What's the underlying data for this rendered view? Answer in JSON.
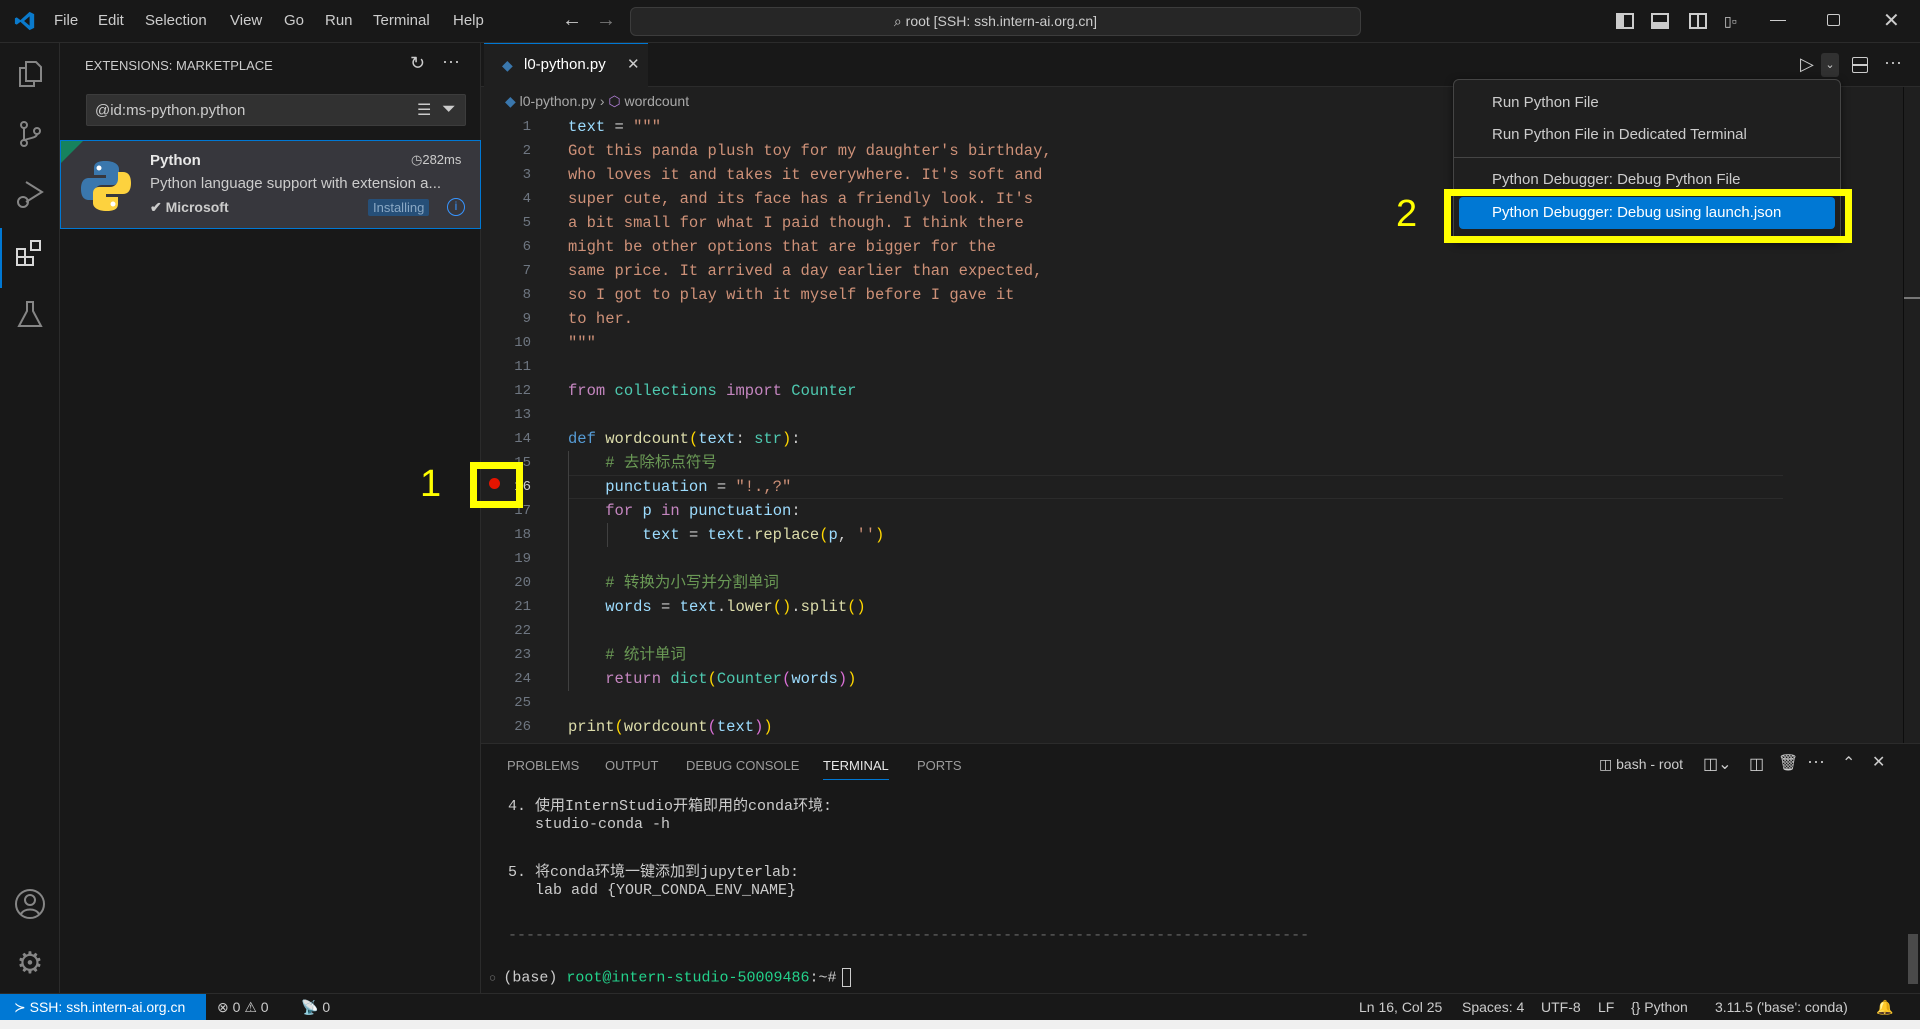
{
  "titlebar": {
    "menus": [
      "File",
      "Edit",
      "Selection",
      "View",
      "Go",
      "Run",
      "Terminal",
      "Help"
    ],
    "command_center": "root [SSH: ssh.intern-ai.org.cn]"
  },
  "sidebar": {
    "title": "EXTENSIONS: MARKETPLACE",
    "search_value": "@id:ms-python.python",
    "extension": {
      "name": "Python",
      "time": "282ms",
      "description": "Python language support with extension a...",
      "publisher": "Microsoft",
      "status": "Installing"
    }
  },
  "editor": {
    "tab": "l0-python.py",
    "breadcrumb": [
      "l0-python.py",
      "wordcount"
    ],
    "current_line": 16,
    "breakpoint_line": 16,
    "lines": [
      [
        [
          "text",
          "var"
        ],
        [
          " = ",
          ""
        ],
        [
          "\"\"\"",
          "str"
        ]
      ],
      [
        [
          "Got this panda plush toy for my daughter's birthday,",
          "str"
        ]
      ],
      [
        [
          "who loves it and takes it everywhere. It's soft and",
          "str"
        ]
      ],
      [
        [
          "super cute, and its face has a friendly look. It's",
          "str"
        ]
      ],
      [
        [
          "a bit small for what I paid though. I think there",
          "str"
        ]
      ],
      [
        [
          "might be other options that are bigger for the",
          "str"
        ]
      ],
      [
        [
          "same price. It arrived a day earlier than expected,",
          "str"
        ]
      ],
      [
        [
          "so I got to play with it myself before I gave it",
          "str"
        ]
      ],
      [
        [
          "to her.",
          "str"
        ]
      ],
      [
        [
          "\"\"\"",
          "str"
        ]
      ],
      [],
      [
        [
          "from",
          "kw"
        ],
        [
          " ",
          ""
        ],
        [
          "collections",
          "cls"
        ],
        [
          " ",
          ""
        ],
        [
          "import",
          "kw"
        ],
        [
          " ",
          ""
        ],
        [
          "Counter",
          "cls"
        ]
      ],
      [],
      [
        [
          "def",
          "def"
        ],
        [
          " ",
          ""
        ],
        [
          "wordcount",
          "fn"
        ],
        [
          "(",
          "b1"
        ],
        [
          "text",
          "var"
        ],
        [
          ": ",
          ""
        ],
        [
          "str",
          "cls"
        ],
        [
          ")",
          "b1"
        ],
        [
          ":",
          ""
        ]
      ],
      [
        [
          "    ",
          ""
        ],
        [
          "# 去除标点符号",
          "cm"
        ]
      ],
      [
        [
          "    ",
          ""
        ],
        [
          "punctuation",
          "var"
        ],
        [
          " = ",
          ""
        ],
        [
          "\"!.,?\"",
          "str"
        ]
      ],
      [
        [
          "    ",
          ""
        ],
        [
          "for",
          "kw"
        ],
        [
          " ",
          ""
        ],
        [
          "p",
          "var"
        ],
        [
          " ",
          ""
        ],
        [
          "in",
          "kw"
        ],
        [
          " ",
          ""
        ],
        [
          "punctuation",
          "var"
        ],
        [
          ":",
          ""
        ]
      ],
      [
        [
          "        ",
          ""
        ],
        [
          "text",
          "var"
        ],
        [
          " = ",
          ""
        ],
        [
          "text",
          "var"
        ],
        [
          ".",
          ""
        ],
        [
          "replace",
          "fn"
        ],
        [
          "(",
          "b1"
        ],
        [
          "p",
          "var"
        ],
        [
          ", ",
          ""
        ],
        [
          "''",
          "str"
        ],
        [
          ")",
          "b1"
        ]
      ],
      [],
      [
        [
          "    ",
          ""
        ],
        [
          "# 转换为小写并分割单词",
          "cm"
        ]
      ],
      [
        [
          "    ",
          ""
        ],
        [
          "words",
          "var"
        ],
        [
          " = ",
          ""
        ],
        [
          "text",
          "var"
        ],
        [
          ".",
          ""
        ],
        [
          "lower",
          "fn"
        ],
        [
          "()",
          "b1"
        ],
        [
          ".",
          ""
        ],
        [
          "split",
          "fn"
        ],
        [
          "()",
          "b1"
        ]
      ],
      [],
      [
        [
          "    ",
          ""
        ],
        [
          "# 统计单词",
          "cm"
        ]
      ],
      [
        [
          "    ",
          ""
        ],
        [
          "return",
          "kw"
        ],
        [
          " ",
          ""
        ],
        [
          "dict",
          "cls"
        ],
        [
          "(",
          "b1"
        ],
        [
          "Counter",
          "cls"
        ],
        [
          "(",
          "b2"
        ],
        [
          "words",
          "var"
        ],
        [
          ")",
          "b2"
        ],
        [
          ")",
          "b1"
        ]
      ],
      [],
      [
        [
          "print",
          "fn"
        ],
        [
          "(",
          "b1"
        ],
        [
          "wordcount",
          "fn"
        ],
        [
          "(",
          "b2"
        ],
        [
          "text",
          "var"
        ],
        [
          ")",
          "b2"
        ],
        [
          ")",
          "b1"
        ]
      ]
    ]
  },
  "run_menu": {
    "items": [
      "Run Python File",
      "Run Python File in Dedicated Terminal",
      "Python Debugger: Debug Python File",
      "Python Debugger: Debug using launch.json"
    ],
    "highlighted": 3
  },
  "annotations": {
    "label1": "1",
    "label2": "2",
    "highlight_color": "#ffff00"
  },
  "panel": {
    "tabs": [
      "PROBLEMS",
      "OUTPUT",
      "DEBUG CONSOLE",
      "TERMINAL",
      "PORTS"
    ],
    "active_tab": "TERMINAL",
    "terminal_name": "bash - root",
    "terminal_lines": [
      "4. 使用InternStudio开箱即用的conda环境:",
      "   studio-conda -h",
      "",
      "5. 将conda环境一键添加到jupyterlab:",
      "   lab add {YOUR_CONDA_ENV_NAME}"
    ],
    "separator": "-----------------------------------------------------------------------------------------",
    "prompt": {
      "env": "(base) ",
      "user_host": "root@intern-studio-50009486",
      "path": ":~#"
    }
  },
  "statusbar": {
    "remote": "SSH: ssh.intern-ai.org.cn",
    "errors": "0",
    "warnings": "0",
    "ports": "0",
    "position": "Ln 16, Col 25",
    "spaces": "Spaces: 4",
    "encoding": "UTF-8",
    "eol": "LF",
    "language": "Python",
    "interpreter": "3.11.5 ('base': conda)"
  },
  "colors": {
    "accent": "#0078d4",
    "breakpoint": "#e51400",
    "terminal_green": "#23d18b"
  }
}
